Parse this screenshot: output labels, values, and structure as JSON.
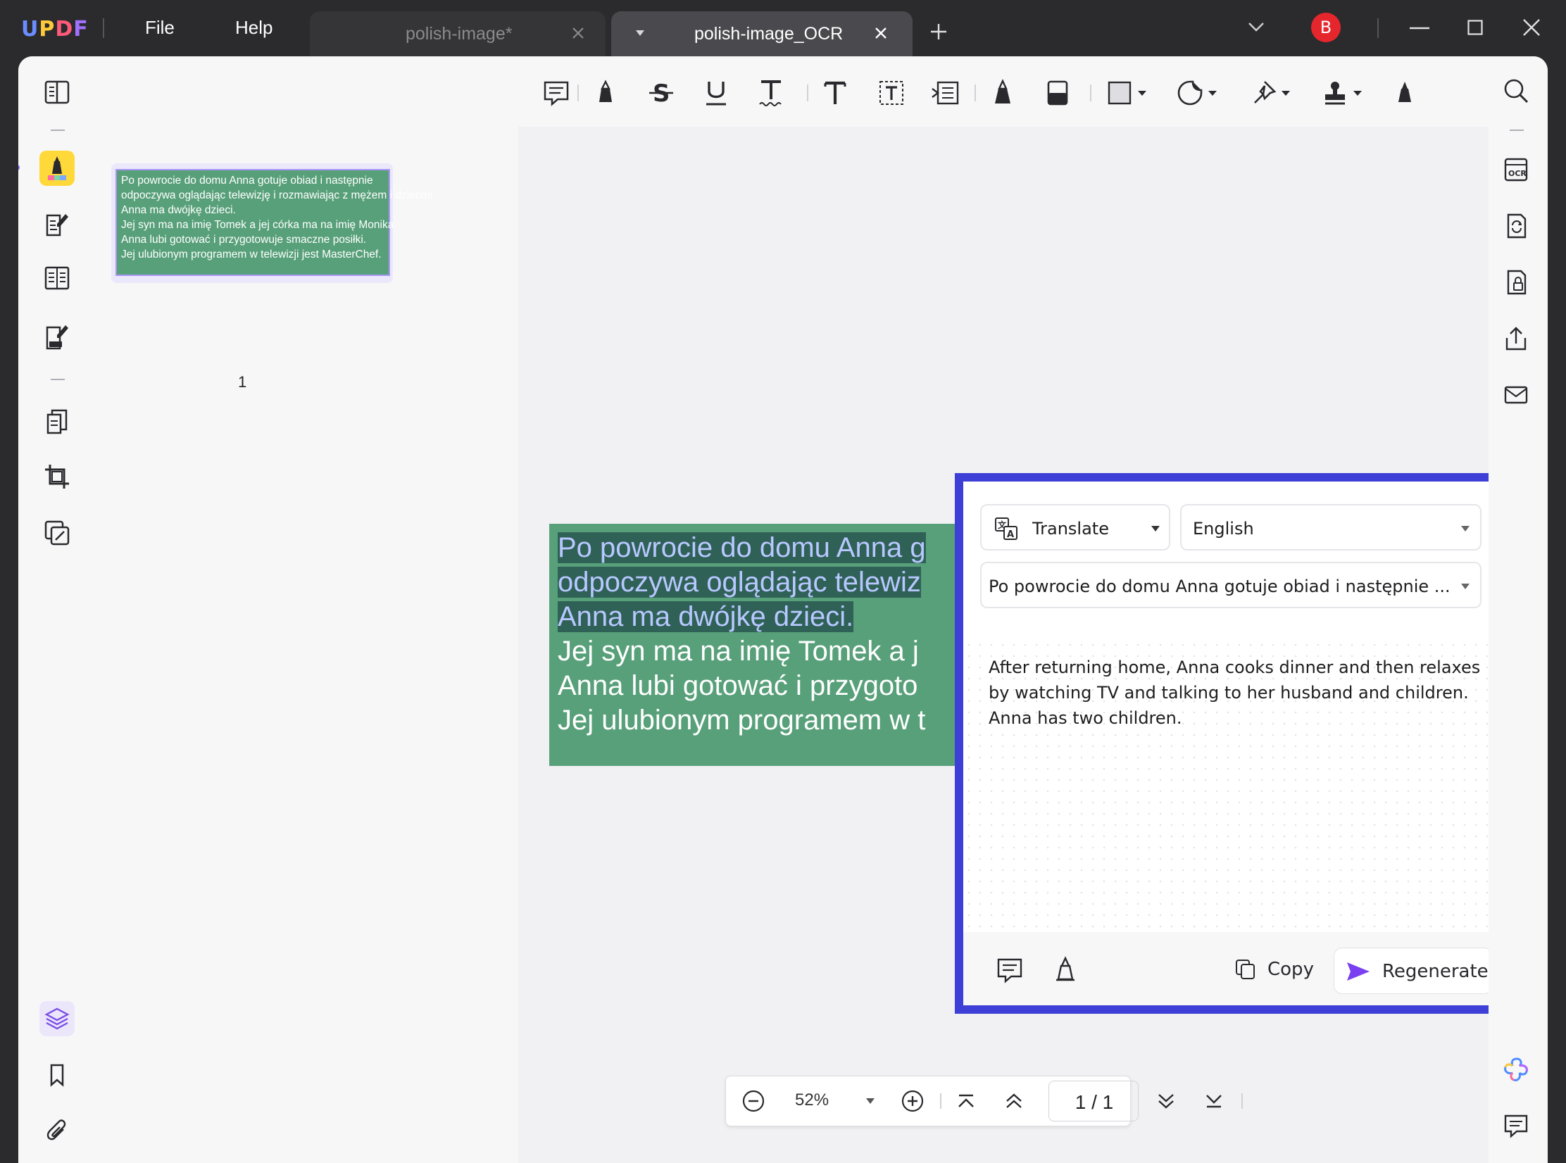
{
  "app": {
    "logo": [
      "U",
      "P",
      "D",
      "F"
    ],
    "logo_colors": [
      "#6b8dff",
      "#ffca3a",
      "#ff5a7a",
      "#a070ff"
    ],
    "menu": [
      "File",
      "Help"
    ]
  },
  "tabs": [
    {
      "title": "polish-image*",
      "active": false
    },
    {
      "title": "polish-image_OCR",
      "active": true
    }
  ],
  "user": {
    "avatar_letter": "B",
    "avatar_color": "#e5262d"
  },
  "thumbnail": {
    "lines": [
      "Po powrocie do domu Anna gotuje obiad i następnie",
      "odpoczywa oglądając telewizję i rozmawiając z mężem i dziećmi.",
      "Anna ma dwójkę dzieci.",
      "Jej syn ma na imię Tomek a jej córka ma na imię Monika.",
      "Anna lubi gotować i przygotowuje smaczne posiłki.",
      "Jej ulubionym programem w telewizji jest MasterChef."
    ],
    "page_number": "1"
  },
  "document": {
    "lines": [
      {
        "text": "Po powrocie do domu Anna g",
        "selected": true
      },
      {
        "text": "odpoczywa oglądając telewiz",
        "selected": true
      },
      {
        "text": "Anna ma dwójkę dzieci.",
        "selected": true
      },
      {
        "text": "Jej syn ma na imię Tomek a j",
        "selected": false
      },
      {
        "text": "Anna lubi gotować i przygoto",
        "selected": false
      },
      {
        "text": "Jej ulubionym programem w t",
        "selected": false
      }
    ],
    "card_color": "#58a07a"
  },
  "ai_panel": {
    "mode": "Translate",
    "language": "English",
    "source_preview": "Po powrocie do domu Anna gotuje obiad i następnie ...",
    "result_lines": [
      "After returning home, Anna cooks dinner and then relaxes",
      "by watching TV and talking to her husband and children.",
      "Anna has two children."
    ],
    "copy_label": "Copy",
    "regenerate_label": "Regenerate",
    "border_color": "#3d3fd6"
  },
  "zoom_bar": {
    "zoom": "52%",
    "page": "1 / 1"
  },
  "icons": {
    "left_rail": [
      "reader-icon",
      "comment-mode-icon",
      "edit-pdf-icon",
      "organize-icon",
      "fill-sign-icon",
      "pages-icon",
      "crop-icon",
      "compress-icon",
      "layers-icon",
      "bookmark-icon",
      "attachment-icon"
    ],
    "right_rail": [
      "search-icon",
      "ocr-icon",
      "convert-icon",
      "protect-icon",
      "share-icon",
      "email-icon",
      "ai-assistant-icon",
      "comments-icon"
    ],
    "toolbar": [
      "note-icon",
      "highlight-icon",
      "strikethrough-icon",
      "underline-icon",
      "squiggly-icon",
      "text-icon",
      "textbox-icon",
      "callout-icon",
      "pencil-icon",
      "eraser-icon",
      "shape-icon",
      "sticker-icon",
      "pin-icon",
      "stamp-icon",
      "signature-icon"
    ]
  }
}
